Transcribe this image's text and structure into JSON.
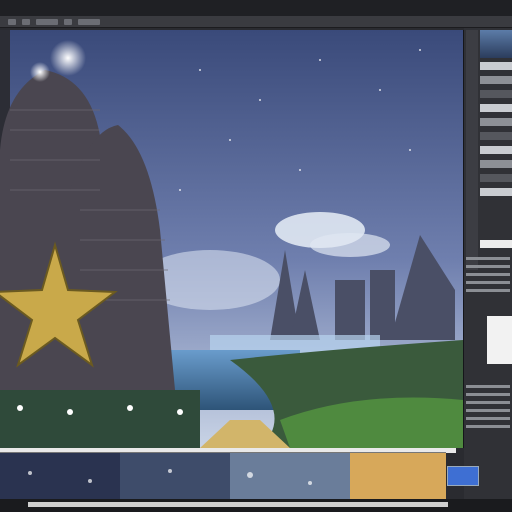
{
  "menubar": {
    "items": [
      "",
      "",
      "",
      "",
      "",
      "",
      "",
      "",
      "",
      "",
      "",
      ""
    ]
  },
  "toolbar": {
    "tools": [
      "move-tool-icon",
      "brush-tool-icon",
      "zoom-tool-icon",
      "layers-icon",
      "settings-icon"
    ]
  },
  "canvas": {
    "description_label": "",
    "colors": {
      "sky_top": "#3a4a7a",
      "sky_mid": "#6f7fae",
      "sky_haze": "#c9d4e6",
      "water": "#4d82b0",
      "castle": "#4a4650",
      "star": "#c9a94a",
      "grass": "#3e6b3a",
      "road": "#d2b56a"
    }
  },
  "right_panel": {
    "accent": "#3e6fd3"
  },
  "filmstrip": {
    "colors": [
      "#2a3350",
      "#6a7d9a",
      "#d7a85a"
    ]
  }
}
